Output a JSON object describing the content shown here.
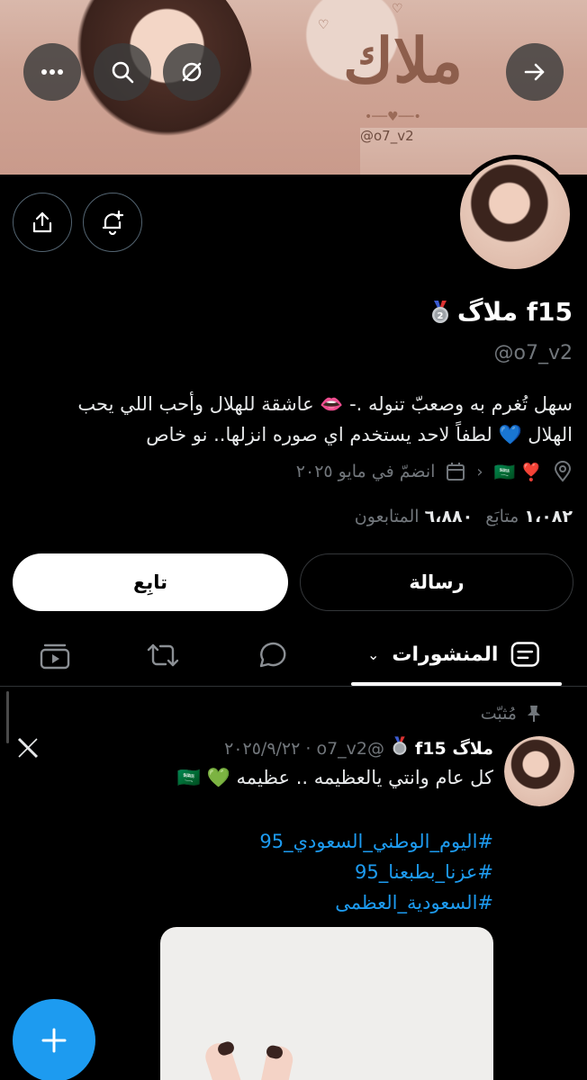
{
  "banner": {
    "title": "ملاك",
    "handle": "@o7_v2",
    "nav": {
      "back_icon": "arrow-right-icon",
      "more_icon": "more-horizontal-icon",
      "search_icon": "search-icon",
      "grok_icon": "grok-icon"
    }
  },
  "profile": {
    "display_name": "ملاگ f15",
    "handle": "@o7_v2",
    "bio_line1": "سهل تُغرم به وصعبّ تنوله .- 👄 عاشقة للهلال وأحب اللي يحب",
    "bio_line2": "الهلال 💙 لطفاً لاحد يستخدم اي صوره انزلها.. نو خاص",
    "location_flags": "❣️ 🇸🇦",
    "joined": "انضمّ في مايو ٢٠٢٥",
    "following_count": "١،٠٨٢",
    "following_label": "متابَع",
    "followers_count": "٦،٨٨٠",
    "followers_label": "المتابعون"
  },
  "actions": {
    "follow_label": "تابِع",
    "message_label": "رسالة"
  },
  "tabs": {
    "active_label": "المنشورات"
  },
  "post": {
    "pinned_label": "مُثبّت",
    "author": "ملاگ f15",
    "handle_date": "@o7_v2 · ٢٠٢٥/٩/٢٢",
    "text": "كل عام وانتي يالعظيمه .. عظيمه 💚 🇸🇦",
    "hashtags": [
      "#اليوم_الوطني_السعودي_95",
      "#عزنا_بطبعنا_95",
      "#السعودية_العظمى"
    ]
  },
  "colors": {
    "accent": "#1d9bf0",
    "muted": "#71767b",
    "background": "#000000"
  }
}
